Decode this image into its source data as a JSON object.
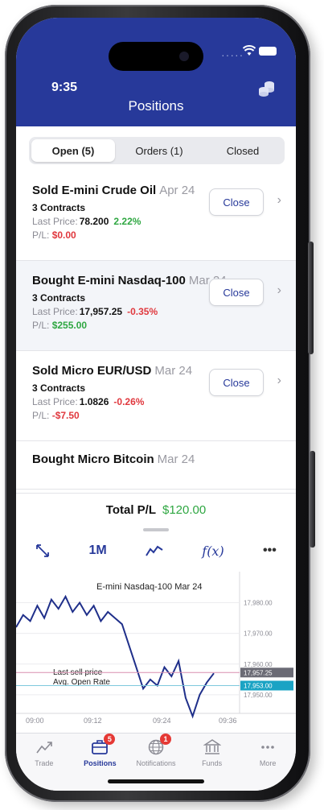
{
  "status": {
    "time": "9:35",
    "dots": "·····"
  },
  "header": {
    "title": "Positions"
  },
  "tabs": [
    {
      "label": "Open (5)",
      "active": true
    },
    {
      "label": "Orders (1)",
      "active": false
    },
    {
      "label": "Closed",
      "active": false
    }
  ],
  "positions": [
    {
      "title": "Sold E-mini Crude Oil",
      "date": "Apr 24",
      "qty": "3 Contracts",
      "price_label": "Last Price:",
      "price": "78.200",
      "change": "2.22%",
      "pl_label": "P/L:",
      "pl": "$0.00",
      "close": "Close"
    },
    {
      "title": "Bought E-mini Nasdaq-100",
      "date": "Mar 24",
      "qty": "3 Contracts",
      "price_label": "Last Price:",
      "price": "17,957.25",
      "change": "-0.35%",
      "pl_label": "P/L:",
      "pl": "$255.00",
      "close": "Close"
    },
    {
      "title": "Sold Micro EUR/USD",
      "date": "Mar 24",
      "qty": "3 Contracts",
      "price_label": "Last Price:",
      "price": "1.0826",
      "change": "-0.26%",
      "pl_label": "P/L:",
      "pl": "-$7.50",
      "close": "Close"
    },
    {
      "title": "Bought Micro Bitcoin",
      "date": "Mar 24"
    }
  ],
  "total": {
    "label": "Total P/L",
    "value": "$120.00"
  },
  "toolbar": {
    "range": "1M",
    "fx": "f(x)",
    "more": "•••"
  },
  "chart_data": {
    "type": "line",
    "title": "E-mini Nasdaq-100 Mar 24",
    "x_ticks": [
      "09:00",
      "09:12",
      "09:24",
      "09:36"
    ],
    "y_ticks": [
      "17,980.00",
      "17,970.00",
      "17,960.00",
      "17,950.00"
    ],
    "ylim": [
      17945,
      17988
    ],
    "series": [
      {
        "values": [
          17972,
          17976,
          17974,
          17979,
          17975,
          17981,
          17978,
          17982,
          17977,
          17980,
          17976,
          17979,
          17974,
          17977,
          17975,
          17973,
          17966,
          17959,
          17952,
          17955,
          17953,
          17959,
          17956,
          17961,
          17949,
          17943,
          17950,
          17954,
          17957
        ]
      }
    ],
    "last_sell_label": "Last sell price",
    "avg_open_label": "Avg. Open Rate",
    "last_sell_value": "17,957.25",
    "avg_open_value": "17,953.00"
  },
  "tabbar": [
    {
      "label": "Trade",
      "icon": "trend-icon",
      "badge": ""
    },
    {
      "label": "Positions",
      "icon": "briefcase-icon",
      "badge": "5"
    },
    {
      "label": "Notifications",
      "icon": "globe-icon",
      "badge": "1"
    },
    {
      "label": "Funds",
      "icon": "bank-icon",
      "badge": ""
    },
    {
      "label": "More",
      "icon": "more-icon",
      "badge": ""
    }
  ]
}
